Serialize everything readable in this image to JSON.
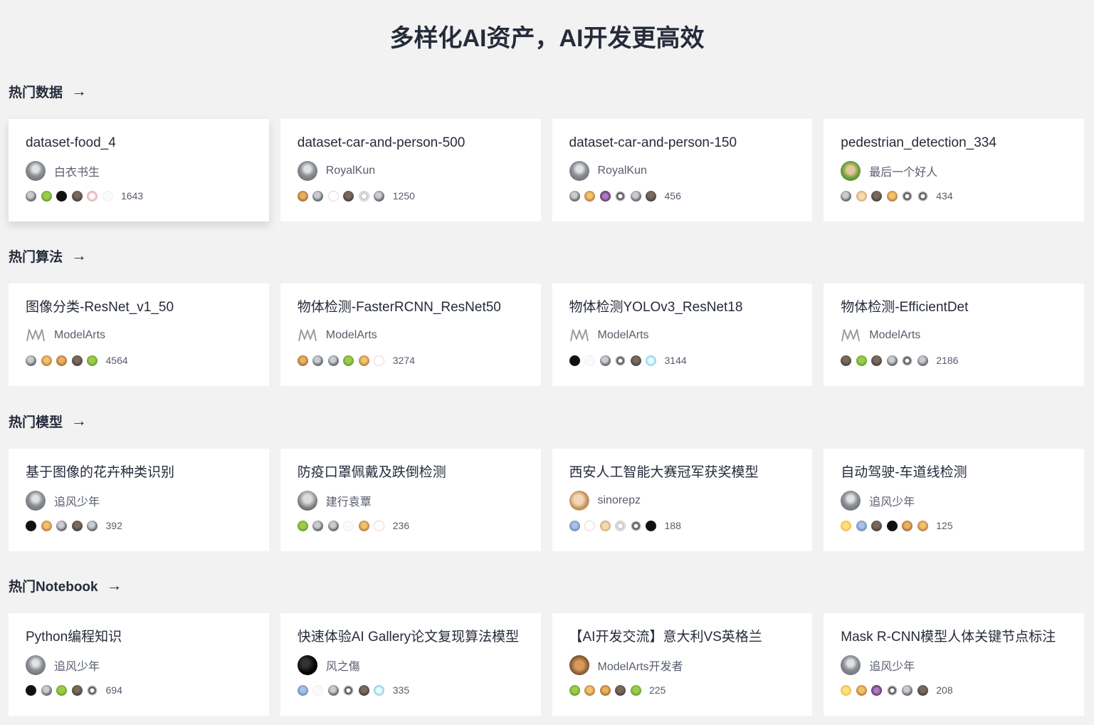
{
  "page_title": "多样化AI资产，AI开发更高效",
  "arrow_glyph": "→",
  "sections": [
    {
      "title": "热门数据",
      "cards": [
        {
          "title": "dataset-food_4",
          "author": "白衣书生",
          "avatar": "dog-avatar",
          "count": "1643",
          "users": [
            "gray",
            "green",
            "black",
            "dark",
            "pink",
            "white"
          ]
        },
        {
          "title": "dataset-car-and-person-500",
          "author": "RoyalKun",
          "avatar": "dog-avatar",
          "count": "1250",
          "users": [
            "brown",
            "gray",
            "red",
            "dark",
            "outline",
            "gray"
          ]
        },
        {
          "title": "dataset-car-and-person-150",
          "author": "RoyalKun",
          "avatar": "dog-avatar",
          "count": "456",
          "users": [
            "gray",
            "orange",
            "purple",
            "figure",
            "gray",
            "dark"
          ]
        },
        {
          "title": "pedestrian_detection_334",
          "author": "最后一个好人",
          "avatar": "green-avatar",
          "count": "434",
          "users": [
            "gray",
            "tan",
            "dark",
            "orange",
            "figure",
            "figure"
          ]
        }
      ]
    },
    {
      "title": "热门算法",
      "cards": [
        {
          "title": "图像分类-ResNet_v1_50",
          "author": "ModelArts",
          "avatar": "modelarts-logo",
          "count": "4564",
          "users": [
            "gray",
            "orange",
            "brown",
            "dark",
            "green"
          ]
        },
        {
          "title": "物体检测-FasterRCNN_ResNet50",
          "author": "ModelArts",
          "avatar": "modelarts-logo",
          "count": "3274",
          "users": [
            "brown",
            "gray",
            "gray",
            "green",
            "orange",
            "red"
          ]
        },
        {
          "title": "物体检测YOLOv3_ResNet18",
          "author": "ModelArts",
          "avatar": "modelarts-logo",
          "count": "3144",
          "users": [
            "black",
            "white",
            "gray",
            "figure",
            "dark",
            "cyan"
          ]
        },
        {
          "title": "物体检测-EfficientDet",
          "author": "ModelArts",
          "avatar": "modelarts-logo",
          "count": "2186",
          "users": [
            "dark",
            "green",
            "dark",
            "gray",
            "figure",
            "gray"
          ]
        }
      ]
    },
    {
      "title": "热门模型",
      "cards": [
        {
          "title": "基于图像的花卉种类识别",
          "author": "追风少年",
          "avatar": "dog-avatar",
          "count": "392",
          "users": [
            "black",
            "orange",
            "gray",
            "dark",
            "gray"
          ]
        },
        {
          "title": "防疫口罩佩戴及跌倒检测",
          "author": "建行袁覃",
          "avatar": "wolf-avatar",
          "count": "236",
          "users": [
            "green",
            "gray",
            "gray",
            "white",
            "orange",
            "red"
          ]
        },
        {
          "title": "西安人工智能大赛冠军获奖模型",
          "author": "sinorepz",
          "avatar": "sino-avatar",
          "count": "188",
          "users": [
            "blue",
            "red",
            "tan",
            "outline",
            "figure",
            "black"
          ]
        },
        {
          "title": "自动驾驶-车道线检测",
          "author": "追风少年",
          "avatar": "dog-avatar",
          "count": "125",
          "users": [
            "duck",
            "blue",
            "dark",
            "black",
            "brown",
            "orange"
          ]
        }
      ]
    },
    {
      "title": "热门Notebook",
      "cards": [
        {
          "title": "Python编程知识",
          "author": "追风少年",
          "avatar": "dog-avatar",
          "count": "694",
          "users": [
            "black",
            "gray",
            "green",
            "dark",
            "figure"
          ]
        },
        {
          "title": "快速体验AI Gallery论文复现算法模型",
          "author": "风之傷",
          "avatar": "black-avatar",
          "count": "335",
          "users": [
            "blue",
            "white",
            "gray",
            "figure",
            "dark",
            "cyan"
          ]
        },
        {
          "title": "【AI开发交流】意大利VS英格兰",
          "author": "ModelArts开发者",
          "avatar": "bear-avatar",
          "count": "225",
          "users": [
            "green",
            "orange",
            "brown",
            "dark",
            "green"
          ]
        },
        {
          "title": "Mask R-CNN模型人体关键节点标注",
          "author": "追风少年",
          "avatar": "dog-avatar",
          "count": "208",
          "users": [
            "duck",
            "orange",
            "purple",
            "figure",
            "gray",
            "dark"
          ]
        }
      ]
    }
  ]
}
